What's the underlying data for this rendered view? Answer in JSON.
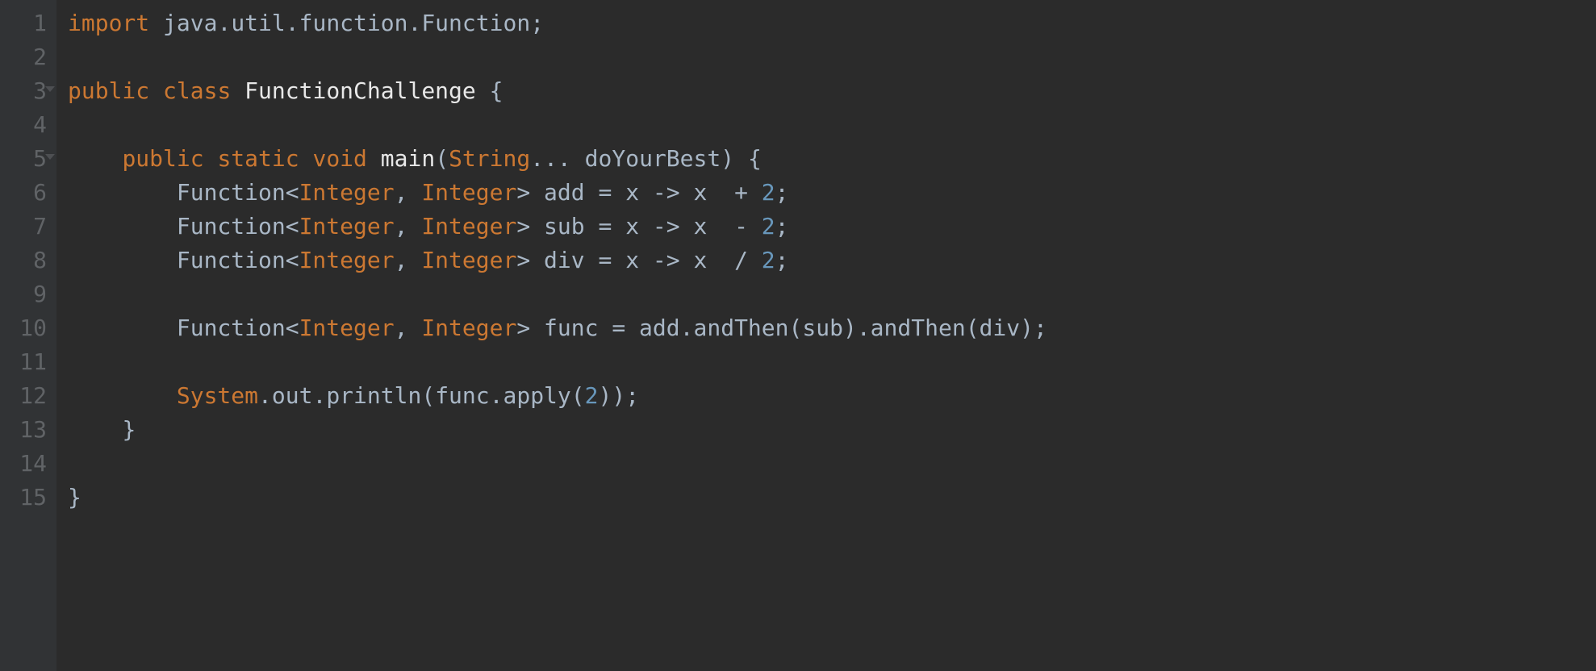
{
  "colors": {
    "background": "#2b2b2b",
    "gutter": "#313335",
    "gutterText": "#606366",
    "keyword": "#cc7832",
    "identifier": "#a9b7c6",
    "number": "#6897bb",
    "classname": "#e8e8e8"
  },
  "lines": {
    "n1": "1",
    "n2": "2",
    "n3": "3",
    "n4": "4",
    "n5": "5",
    "n6": "6",
    "n7": "7",
    "n8": "8",
    "n9": "9",
    "n10": "10",
    "n11": "11",
    "n12": "12",
    "n13": "13",
    "n14": "14",
    "n15": "15"
  },
  "tokens": {
    "import": "import",
    "pkg_java": " java",
    "dot1": ".",
    "pkg_util": "util",
    "dot2": ".",
    "pkg_function": "function",
    "dot3": ".",
    "cls_Function": "Function",
    "semi": ";",
    "public": "public",
    "class": "class",
    "cls_FunctionChallenge": "FunctionChallenge",
    "lbrace": " {",
    "static": "static",
    "void": "void",
    "main": "main",
    "lparen": "(",
    "String": "String",
    "varargs": "...",
    "doYourBest": " doYourBest",
    "rparen": ")",
    "lbrace2": " {",
    "lt": "<",
    "Integer": "Integer",
    "gt": ">",
    "comma": ", ",
    "add": " add ",
    "eq": "=",
    "x": " x ",
    "arrow": "->",
    "plus": " + ",
    "n2": "2",
    "sub": " sub ",
    "minus": " - ",
    "div": " div ",
    "slash": " / ",
    "func": " func ",
    "addId": " add",
    "andThen": "andThen",
    "subId": "sub",
    "divId": "div",
    "System": "System",
    "out": "out",
    "println": "println",
    "funcId": "func",
    "apply": "apply",
    "rbrace": "}",
    "sp4": "    ",
    "sp8": "        "
  }
}
